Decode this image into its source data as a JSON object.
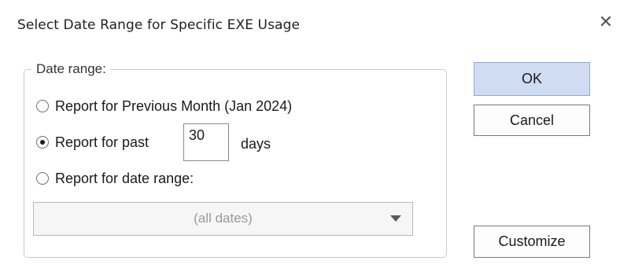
{
  "window": {
    "title": "Select Date Range for Specific EXE Usage",
    "close_glyph": "✕"
  },
  "group": {
    "legend": "Date range:"
  },
  "options": {
    "previous_month": {
      "label": "Report for Previous Month (Jan 2024)",
      "checked": false
    },
    "past_days": {
      "label": "Report for past",
      "checked": true,
      "days_value": "30",
      "days_suffix": "days"
    },
    "date_range": {
      "label": "Report for date range:",
      "checked": false
    }
  },
  "date_select": {
    "selected": "(all dates)",
    "disabled": true
  },
  "buttons": {
    "ok": "OK",
    "cancel": "Cancel",
    "customize": "Customize"
  },
  "colors": {
    "default_button_bg": "#cfdcf2",
    "default_button_border": "#8fa9d6"
  },
  "icons": {
    "close": "close-icon",
    "dropdown": "chevron-down-icon",
    "radio": "radio-icon"
  }
}
